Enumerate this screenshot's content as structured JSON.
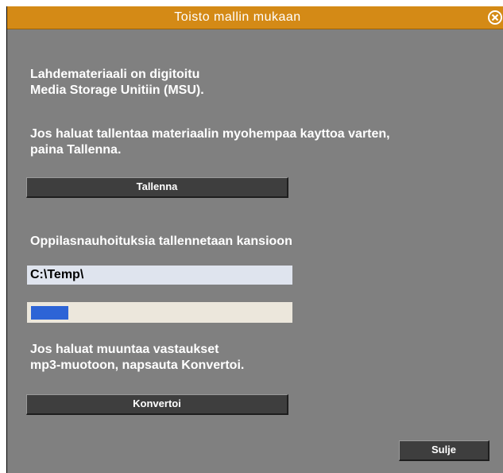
{
  "window": {
    "title": "Toisto mallin mukaan",
    "close_icon": "close-circle-icon",
    "accent_color": "#d48a16",
    "background_color": "#808080"
  },
  "content": {
    "intro_line1": "Lahdemateriaali on digitoitu",
    "intro_line2": "Media Storage Unitiin (MSU).",
    "save_hint_line1": "Jos haluat tallentaa materiaalin myohempaa kayttoa varten,",
    "save_hint_line2": "paina Tallenna.",
    "save_button": "Tallenna",
    "folder_label": "Oppilasnauhoituksia tallennetaan kansioon",
    "folder_path": "C:\\Temp\\",
    "progress_fraction": 0.04,
    "convert_hint_line1": "Jos haluat muuntaa vastaukset",
    "convert_hint_line2": "mp3-muotoon, napsauta Konvertoi.",
    "convert_button": "Konvertoi",
    "close_button": "Sulje"
  }
}
